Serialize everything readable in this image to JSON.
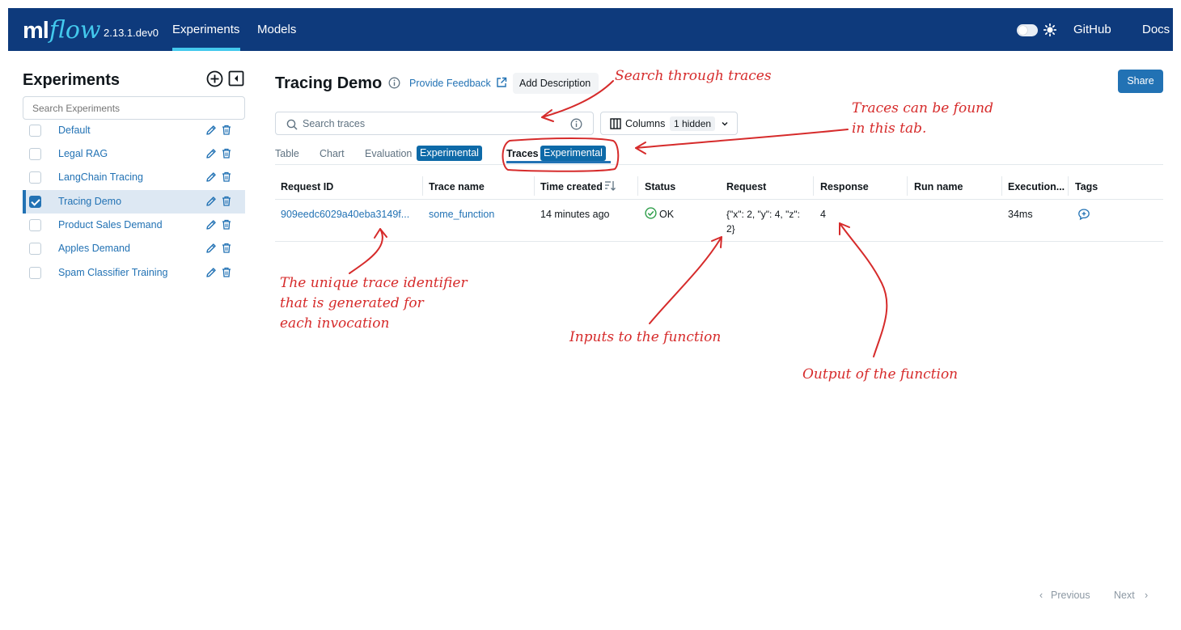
{
  "nav": {
    "logo_ml": "ml",
    "logo_flow": "flow",
    "version": "2.13.1.dev0",
    "links": [
      "Experiments",
      "Models"
    ],
    "github": "GitHub",
    "docs": "Docs"
  },
  "sidebar": {
    "title": "Experiments",
    "search_placeholder": "Search Experiments",
    "items": [
      {
        "label": "Default",
        "checked": false
      },
      {
        "label": "Legal RAG",
        "checked": false
      },
      {
        "label": "LangChain Tracing",
        "checked": false
      },
      {
        "label": "Tracing Demo",
        "checked": true
      },
      {
        "label": "Product Sales Demand",
        "checked": false
      },
      {
        "label": "Apples Demand",
        "checked": false
      },
      {
        "label": "Spam Classifier Training",
        "checked": false
      }
    ]
  },
  "header": {
    "title": "Tracing Demo",
    "feedback": "Provide Feedback",
    "add_description": "Add Description",
    "share": "Share"
  },
  "toolbar": {
    "search_placeholder": "Search traces",
    "columns_label": "Columns",
    "hidden_count": "1 hidden"
  },
  "tabs": {
    "table": "Table",
    "chart": "Chart",
    "evaluation": "Evaluation",
    "traces": "Traces",
    "badge": "Experimental"
  },
  "table": {
    "headers": [
      "Request ID",
      "Trace name",
      "Time created",
      "Status",
      "Request",
      "Response",
      "Run name",
      "Execution...",
      "Tags"
    ],
    "rows": [
      {
        "request_id": "909eedc6029a40eba3149f...",
        "trace_name": "some_function",
        "time_created": "14 minutes ago",
        "status": "OK",
        "request": "{\"x\": 2, \"y\": 4, \"z\": 2}",
        "response": "4",
        "run_name": "",
        "execution": "34ms"
      }
    ]
  },
  "pagination": {
    "previous": "Previous",
    "next": "Next"
  },
  "annotations": {
    "search": "Search through traces",
    "traces_tab_1": "Traces can be found",
    "traces_tab_2": "in this tab.",
    "identifier_1": "The unique trace identifier",
    "identifier_2": "that is generated for",
    "identifier_3": "each invocation",
    "inputs": "Inputs to the function",
    "output": "Output of the function",
    "color": "#d62b2b"
  },
  "colors": {
    "nav_bg": "#0e3a7c",
    "accent": "#43c9ed",
    "link": "#2272b4",
    "badge": "#0e6aa8",
    "ok": "#2e9e4a"
  }
}
